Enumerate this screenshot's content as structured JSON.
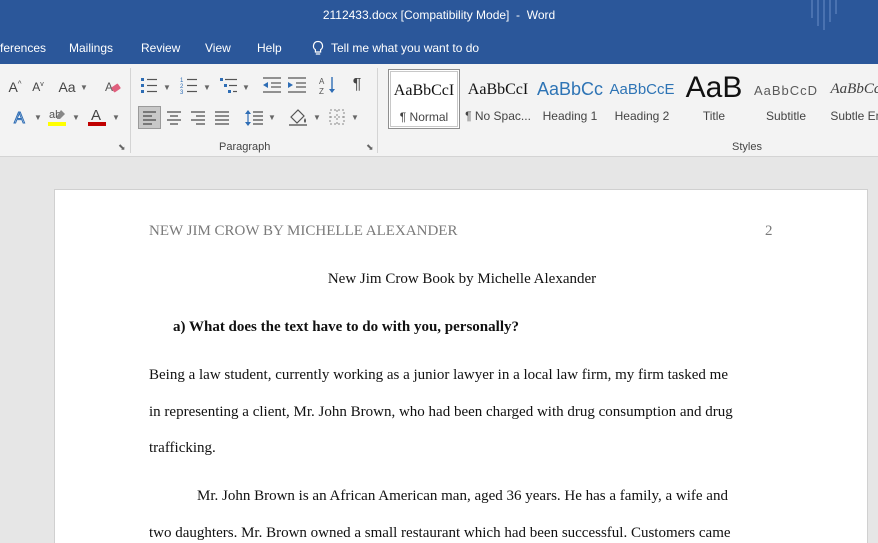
{
  "window": {
    "title": "2112433.docx [Compatibility Mode]  -  Word"
  },
  "menu": {
    "tabs": [
      "ferences",
      "Mailings",
      "Review",
      "View",
      "Help"
    ],
    "tell_me": "Tell me what you want to do"
  },
  "ribbon": {
    "font_group": {
      "change_case": "Aa"
    },
    "paragraph_group": {
      "label": "Paragraph"
    },
    "styles_group": {
      "label": "Styles",
      "styles": [
        {
          "sample": "AaBbCcI",
          "name": "¶ Normal"
        },
        {
          "sample": "AaBbCcI",
          "name": "¶ No Spac..."
        },
        {
          "sample": "AaBbCc",
          "name": "Heading 1"
        },
        {
          "sample": "AaBbCcE",
          "name": "Heading 2"
        },
        {
          "sample": "AaB",
          "name": "Title"
        },
        {
          "sample": "AaBbCcD",
          "name": "Subtitle"
        },
        {
          "sample": "AaBbCcI",
          "name": "Subtle Em"
        }
      ]
    },
    "colors": {
      "highlight": "#ffff00",
      "font_color": "#c00000"
    }
  },
  "document": {
    "header_left": "NEW JIM CROW BY MICHELLE ALEXANDER",
    "page_number": "2",
    "title": "New Jim Crow Book by Michelle Alexander",
    "question": "a)   What does the text have to do with you, personally?",
    "lines": [
      "Being a law student, currently working as a junior lawyer in a local law firm, my firm tasked me",
      "in representing a client, Mr. John Brown, who had been charged with drug consumption and drug",
      "trafficking.",
      "Mr. John Brown is an African American man, aged 36 years. He has a family, a wife and",
      "two daughters. Mr. Brown owned a small restaurant which had been successful. Customers came"
    ]
  }
}
